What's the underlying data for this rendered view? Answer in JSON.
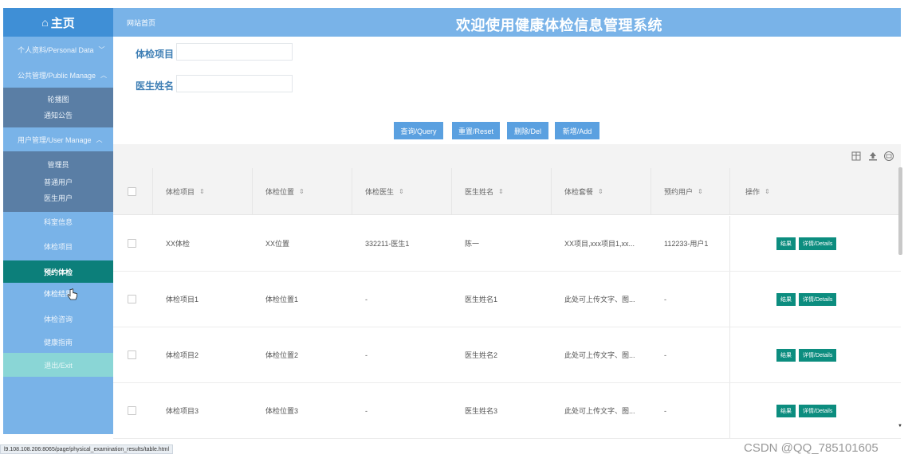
{
  "sidebar": {
    "logo": "主页",
    "logo_icon": "home-icon",
    "groups": [
      {
        "label": "个人资料/Personal Data",
        "expanded": false
      },
      {
        "label": "公共管理/Public Manage",
        "expanded": true
      },
      {
        "label": "用户管理/User Manage",
        "expanded": true
      }
    ],
    "public_items": [
      "轮播图",
      "通知公告"
    ],
    "user_items": [
      "管理员",
      "普通用户",
      "医生用户"
    ],
    "top_items": [
      "科室信息",
      "体检项目",
      "预约体检",
      "体检结果",
      "体检咨询",
      "健康指南",
      "退出/Exit"
    ],
    "active_item": "预约体检"
  },
  "header": {
    "breadcrumb": "网站首页",
    "title": "欢迎使用健康体检信息管理系统"
  },
  "search": {
    "fields": [
      {
        "label": "体检项目",
        "value": ""
      },
      {
        "label": "医生姓名",
        "value": ""
      }
    ],
    "buttons": [
      "查询/Query",
      "重置/Reset",
      "删除/Del",
      "新增/Add"
    ]
  },
  "toolbar_icons": [
    "columns-icon",
    "export-icon",
    "print-icon"
  ],
  "table": {
    "columns": [
      "体检项目",
      "体检位置",
      "体检医生",
      "医生姓名",
      "体检套餐",
      "预约用户",
      "操作"
    ],
    "rows": [
      [
        "XX体检",
        "XX位置",
        "332211-医生1",
        "陈一",
        "XX项目,xxx项目1,xx...",
        "112233-用户1"
      ],
      [
        "体检项目1",
        "体检位置1",
        "-",
        "医生姓名1",
        "此处可上传文字、图...",
        "-"
      ],
      [
        "体检项目2",
        "体检位置2",
        "-",
        "医生姓名2",
        "此处可上传文字、图...",
        "-"
      ],
      [
        "体检项目3",
        "体检位置3",
        "-",
        "医生姓名3",
        "此处可上传文字、图...",
        "-"
      ]
    ],
    "row_actions": [
      "结果",
      "详情/Details"
    ]
  },
  "status_url": "l9.108.108.206:8065/page/physical_examination_results/table.html",
  "watermark": "CSDN @QQ_785101605",
  "colors": {
    "sidebar": "#79b3e8",
    "logo_bar": "#3f8fd6",
    "submenu": "#5a7ea5",
    "active": "#0c7f7a",
    "exit": "#8ad6d6",
    "button": "#5aa0e0",
    "action_button": "#0c8d7f"
  }
}
